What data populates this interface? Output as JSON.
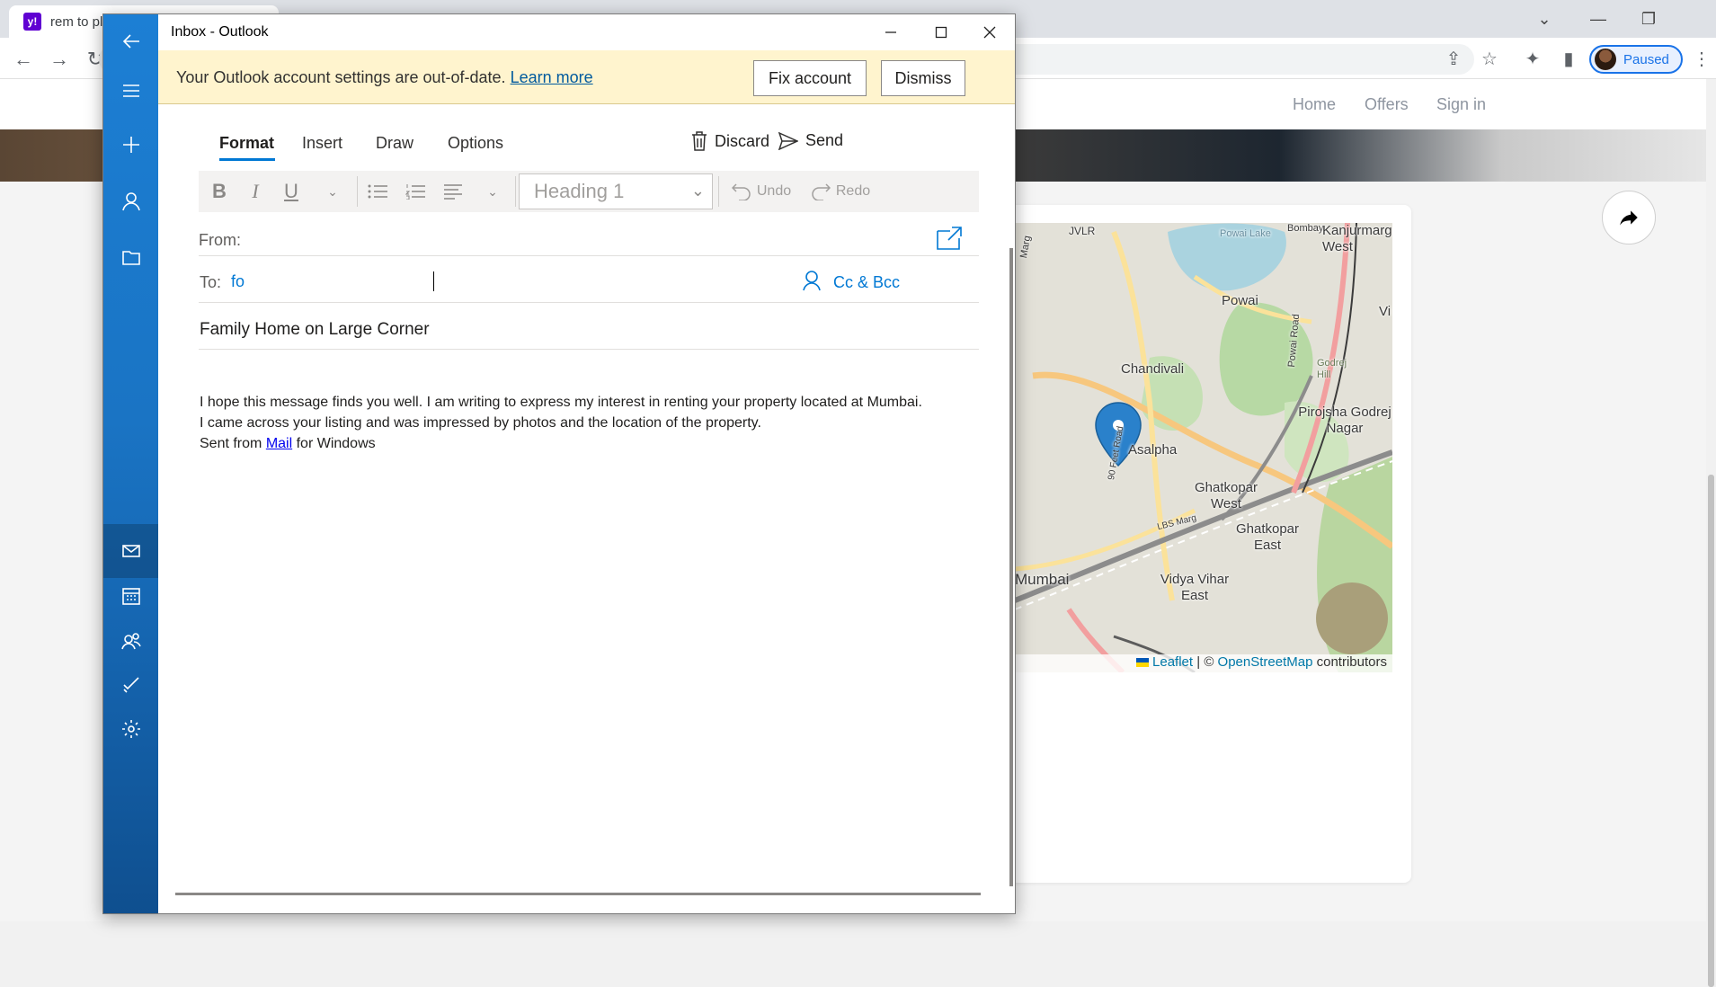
{
  "browser": {
    "active_tab_title": "rem to pl",
    "profile_status": "Paused",
    "site_nav": [
      "Home",
      "Offers",
      "Sign in"
    ]
  },
  "map": {
    "labels": {
      "jvlr": "JVLR",
      "powai_lake": "Powai Lake",
      "bombay": "Bombay",
      "kanjurmarg": "Kanjurmarg West",
      "powai": "Powai",
      "chandivali": "Chandivali",
      "powai_road": "Powai Road",
      "godrej_hill": "Godrej Hill",
      "pirojsha": "Pirojsha Godrej Nagar",
      "feet_road": "90 Feet Road",
      "asalpha": "Asalpha",
      "ghatkopar_west": "Ghatkopar West",
      "lbs_marg": "LBS Marg",
      "ghatkopar_east": "Ghatkopar East",
      "mumbai": "Mumbai",
      "vidya_vihar": "Vidya Vihar East",
      "marg": "Marg",
      "vi": "Vi"
    },
    "attribution": {
      "leaflet": "Leaflet",
      "sep": "| ©",
      "osm": "OpenStreetMap",
      "contrib": "contributors"
    }
  },
  "outlook": {
    "window_title": "Inbox - Outlook",
    "banner": {
      "message": "Your Outlook account settings are out-of-date.",
      "learn_more": "Learn more",
      "fix_account": "Fix account",
      "dismiss": "Dismiss"
    },
    "tabs": [
      "Format",
      "Insert",
      "Draw",
      "Options"
    ],
    "active_tab": "Format",
    "actions": {
      "discard": "Discard",
      "send": "Send"
    },
    "format_toolbar": {
      "bold": "B",
      "italic": "I",
      "underline": "U",
      "heading_style": "Heading 1",
      "undo": "Undo",
      "redo": "Redo"
    },
    "from_label": "From:",
    "to_label": "To:",
    "to_value": "fo",
    "cc_bcc": "Cc & Bcc",
    "subject": "Family Home on Large Corner",
    "body": {
      "line1": "I hope this message finds you well. I am writing to express my interest in renting your property located at Mumbai.",
      "line2": "I came across your listing and was impressed by photos and the location of the property.",
      "sig_prefix": "Sent from",
      "sig_link": "Mail",
      "sig_suffix": "for Windows"
    }
  }
}
